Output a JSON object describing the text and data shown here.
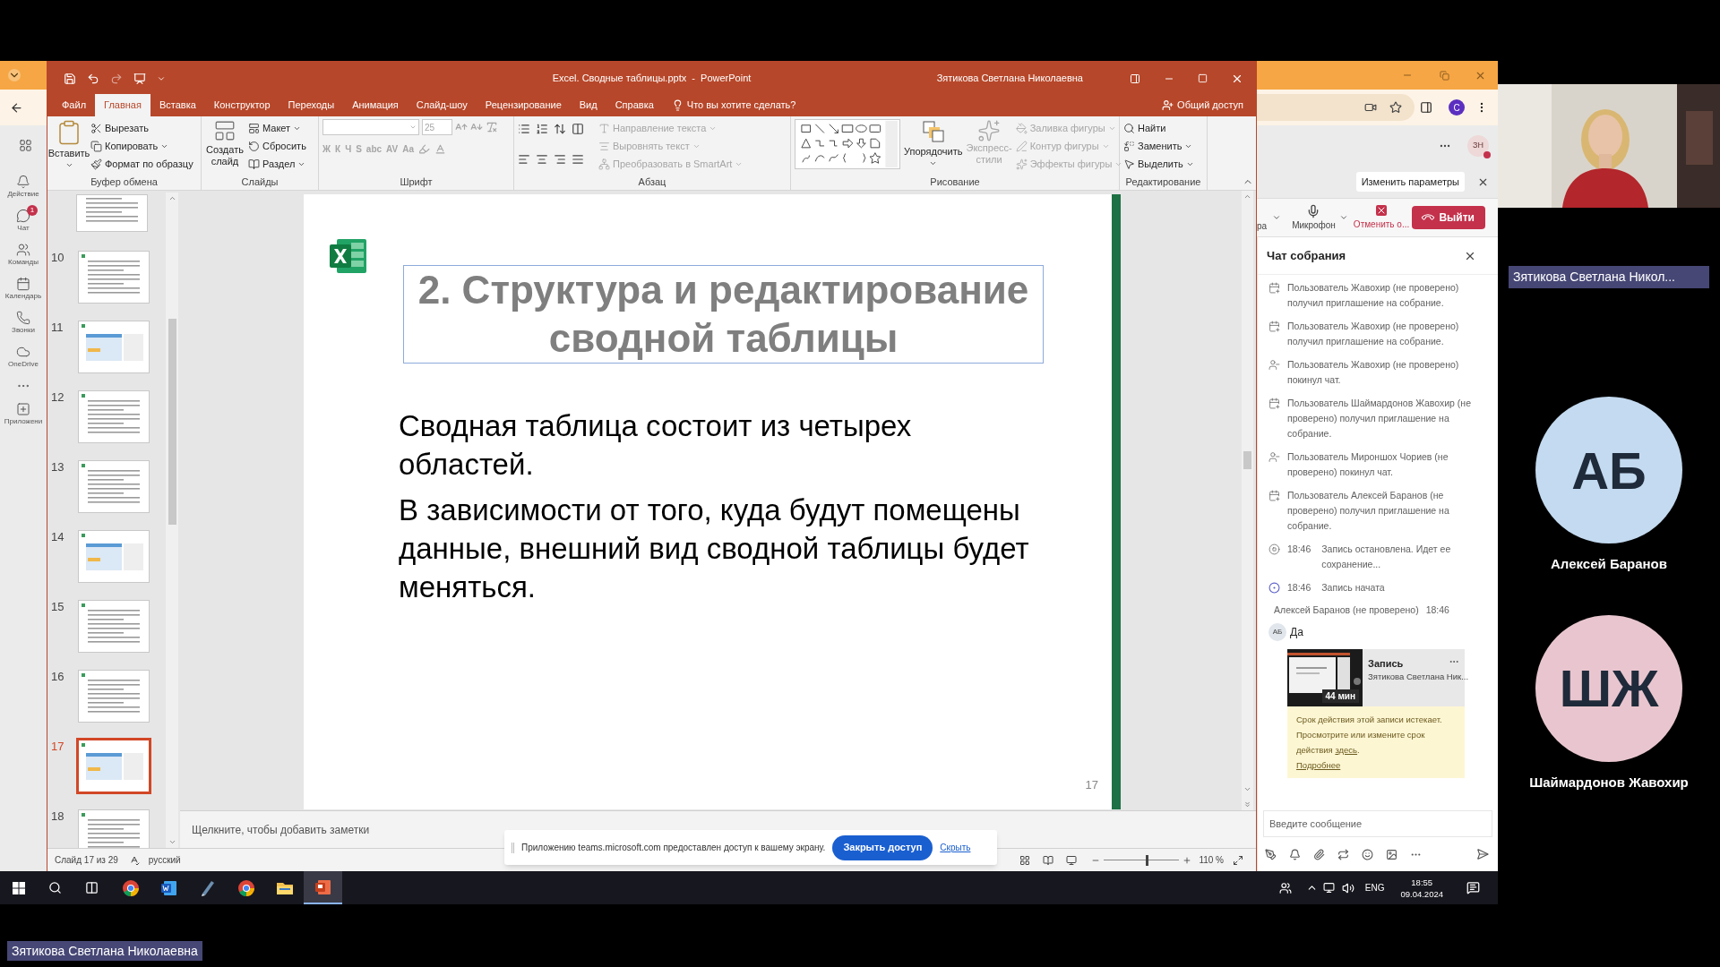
{
  "teams_rail": {
    "items": [
      {
        "kind": "bell",
        "label": "Действие"
      },
      {
        "kind": "chat",
        "label": "Чат",
        "badge": "1"
      },
      {
        "kind": "teams",
        "label": "Команды"
      },
      {
        "kind": "calendar",
        "label": "Календарь"
      },
      {
        "kind": "calls",
        "label": "Звонки"
      },
      {
        "kind": "cloud",
        "label": "OneDrive"
      },
      {
        "kind": "more"
      },
      {
        "kind": "apps",
        "label": "Приложени"
      }
    ]
  },
  "powerpoint": {
    "title": "Excel. Сводные таблицы.pptx  -  PowerPoint",
    "user": "Зятикова Светлана Николаевна",
    "tabs": [
      {
        "label": "Файл",
        "selected": false
      },
      {
        "label": "Главная",
        "selected": true
      },
      {
        "label": "Вставка",
        "selected": false
      },
      {
        "label": "Конструктор",
        "selected": false
      },
      {
        "label": "Переходы",
        "selected": false
      },
      {
        "label": "Анимация",
        "selected": false
      },
      {
        "label": "Слайд-шоу",
        "selected": false
      },
      {
        "label": "Рецензирование",
        "selected": false
      },
      {
        "label": "Вид",
        "selected": false
      },
      {
        "label": "Справка",
        "selected": false
      }
    ],
    "tell_me": "Что вы хотите сделать?",
    "share": "Общий доступ",
    "ribbon": {
      "clipboard": {
        "label": "Буфер обмена",
        "paste": "Вставить",
        "cut": "Вырезать",
        "copy": "Копировать",
        "format_painter": "Формат по образцу"
      },
      "slides": {
        "label": "Слайды",
        "new_slide": "Создать слайд",
        "layout": "Макет",
        "reset": "Сбросить",
        "section": "Раздел"
      },
      "font": {
        "label": "Шрифт",
        "size": "25",
        "disabled": true,
        "format_buttons": [
          "Ж",
          "К",
          "Ч",
          "S",
          "abc",
          "AV",
          "Aa"
        ]
      },
      "paragraph": {
        "label": "Абзац",
        "commands": [
          {
            "label": "Направление текста",
            "disabled": true
          },
          {
            "label": "Выровнять текст",
            "disabled": true
          },
          {
            "label": "Преобразовать в SmartArt",
            "disabled": true
          }
        ]
      },
      "drawing": {
        "label": "Рисование",
        "arrange": "Упорядочить",
        "quick_styles": {
          "label": "Экспресс-стили",
          "disabled": true
        },
        "commands": [
          {
            "label": "Заливка фигуры",
            "disabled": true
          },
          {
            "label": "Контур фигуры",
            "disabled": true
          },
          {
            "label": "Эффекты фигуры",
            "disabled": true
          }
        ]
      },
      "editing": {
        "label": "Редактирование",
        "commands": [
          "Найти",
          "Заменить",
          "Выделить"
        ]
      }
    },
    "thumbnails": [
      {
        "number": "10",
        "selected": false
      },
      {
        "number": "11",
        "selected": false
      },
      {
        "number": "12",
        "selected": false
      },
      {
        "number": "13",
        "selected": false
      },
      {
        "number": "14",
        "selected": false
      },
      {
        "number": "15",
        "selected": false
      },
      {
        "number": "16",
        "selected": false
      },
      {
        "number": "17",
        "selected": true
      },
      {
        "number": "18",
        "selected": false
      }
    ],
    "slide": {
      "title": "2. Структура и редактирование сводной таблицы",
      "paragraphs": [
        "Сводная таблица состоит из четырех областей.",
        "В зависимости от того, куда будут помещены данные, внешний вид сводной таблицы будет меняться."
      ],
      "page_number": "17"
    },
    "notes_placeholder": "Щелкните, чтобы добавить заметки",
    "status_bar": {
      "slide": "Слайд 17 из 29",
      "language": "русский",
      "zoom": "110 %",
      "level": 0.55
    },
    "share_banner": {
      "text": "Приложению teams.microsoft.com предоставлен доступ к вашему экрану.",
      "stop": "Закрыть доступ",
      "hide": "Скрыть"
    }
  },
  "browser": {
    "avatar": "C"
  },
  "teams": {
    "header_avatar": "ЗН",
    "change_settings": "Изменить параметры",
    "controls": {
      "camera_cut": "ра",
      "mic": "Микрофон",
      "stop": "Отменить о...",
      "leave": "Выйти"
    },
    "chat": {
      "title": "Чат собрания",
      "events": [
        {
          "kind": "invite",
          "text": "Пользователь Жавохир (не проверено) получил приглашение на собрание."
        },
        {
          "kind": "invite",
          "text": "Пользователь Жавохир (не проверено) получил приглашение на собрание."
        },
        {
          "kind": "left",
          "text": "Пользователь Жавохир (не проверено) покинул чат."
        },
        {
          "kind": "invite",
          "text": "Пользователь Шаймардонов Жавохир (не проверено) получил приглашение на собрание."
        },
        {
          "kind": "left",
          "text": "Пользователь Мироншох Чориев (не проверено) покинул чат."
        },
        {
          "kind": "invite",
          "text": "Пользователь Алексей Баранов (не проверено) получил приглашение на собрание."
        },
        {
          "kind": "recording_stopped",
          "time": "18:46",
          "text": "Запись остановлена. Идет ее сохранение..."
        },
        {
          "kind": "recording_started",
          "time": "18:46",
          "text": "Запись начата"
        }
      ],
      "message": {
        "author": "Алексей Баранов (не проверено)",
        "time": "18:46",
        "avatar": "АБ",
        "text": "Да"
      },
      "recording": {
        "duration": "44 мин",
        "title": "Запись",
        "owner": "Зятикова Светлана Ник...",
        "note": "Срок действия этой записи истекает. Просмотрите или измените срок действия",
        "link": "здесь",
        "note_end": ".",
        "more": "Подробнее"
      },
      "input_placeholder": "Введите сообщение"
    }
  },
  "taskbar": {
    "apps": [
      {
        "kind": "chrome",
        "selected": false
      },
      {
        "kind": "word",
        "selected": false
      },
      {
        "kind": "notes",
        "selected": false
      },
      {
        "kind": "chrome",
        "selected": false
      },
      {
        "kind": "explorer",
        "selected": false
      },
      {
        "kind": "powerpoint",
        "selected": true
      }
    ],
    "language": "ENG",
    "time": "18:55",
    "date": "09.04.2024"
  },
  "participants": {
    "presenter_tag": "Зятикова Светлана Никол...",
    "people": [
      {
        "initials": "АБ",
        "name": "Алексей Баранов",
        "color": "#c3daf0"
      },
      {
        "initials": "ШЖ",
        "name": "Шаймардонов Жавохир",
        "color": "#e9c6cf"
      }
    ]
  },
  "name_tag": "Зятикова Светлана Николаевна"
}
